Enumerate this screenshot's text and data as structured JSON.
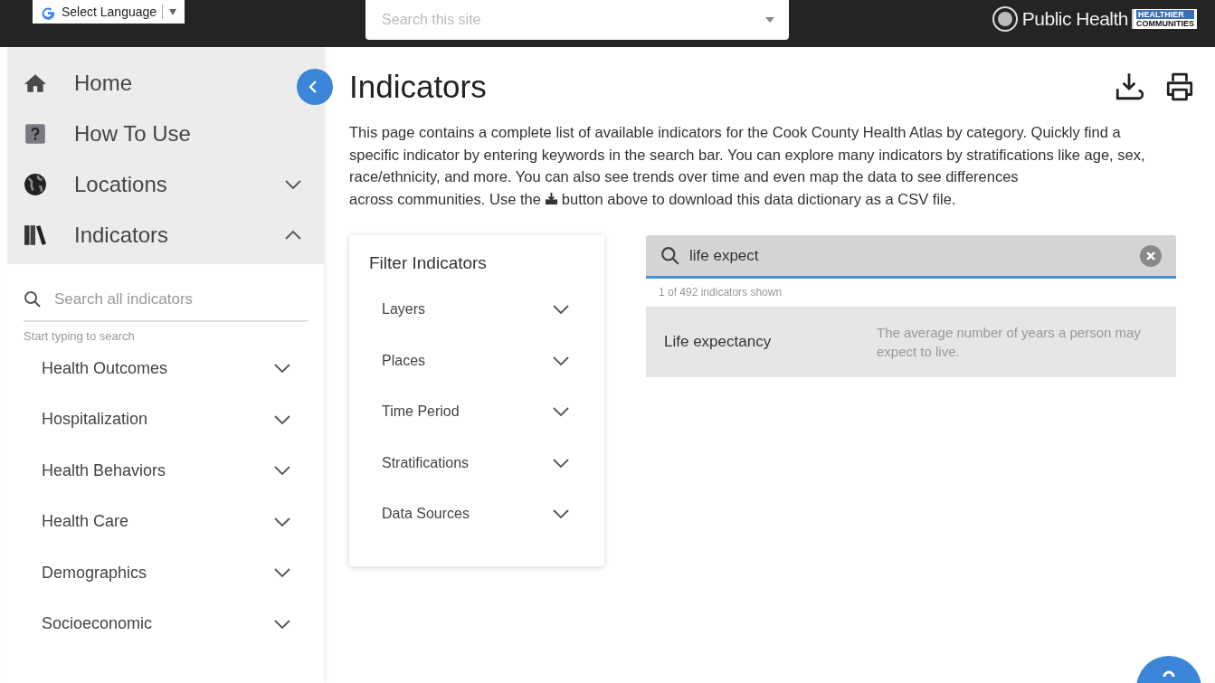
{
  "topbar": {
    "language": "Select Language",
    "site_search": {
      "placeholder": "Search this site"
    },
    "logo": {
      "title": "Public Health",
      "badge_top": "HEALTHIER",
      "badge_bottom": "COMMUNITIES"
    }
  },
  "sidebar": {
    "nav": [
      {
        "kind": "home",
        "label": "Home"
      },
      {
        "kind": "help",
        "label": "How To Use"
      },
      {
        "kind": "globe",
        "label": "Locations",
        "expanded": false
      },
      {
        "kind": "books",
        "label": "Indicators",
        "expanded": true
      }
    ],
    "search": {
      "placeholder": "Search all indicators",
      "hint": "Start typing to search"
    },
    "categories": [
      {
        "label": "Health Outcomes",
        "expanded": false
      },
      {
        "label": "Hospitalization",
        "expanded": false
      },
      {
        "label": "Health Behaviors",
        "expanded": false
      },
      {
        "label": "Health Care",
        "expanded": false
      },
      {
        "label": "Demographics",
        "expanded": false
      },
      {
        "label": "Socioeconomic",
        "expanded": false
      }
    ]
  },
  "main": {
    "title": "Indicators",
    "description": [
      "This page contains a complete list of available indicators for the Cook County Health Atlas by category. Quickly find a specific indicator by entering keywords in the search bar. You can explore many indicators by stratifications like age, sex, race/ethnicity, and more. You can also see trends over time and even map the data to see differences",
      "across communities. Use the",
      "button above to download this data dictionary as a CSV file."
    ],
    "filter": {
      "title": "Filter Indicators",
      "items": [
        {
          "label": "Layers",
          "expanded": false
        },
        {
          "label": "Places",
          "expanded": false
        },
        {
          "label": "Time Period",
          "expanded": false
        },
        {
          "label": "Stratifications",
          "expanded": false
        },
        {
          "label": "Data Sources",
          "expanded": false
        }
      ]
    },
    "search": {
      "value": "life expect",
      "count": "1 of 492 indicators shown"
    },
    "results": [
      {
        "name": "Life expectancy",
        "description": "The average number of years a person may expect to live."
      }
    ]
  }
}
